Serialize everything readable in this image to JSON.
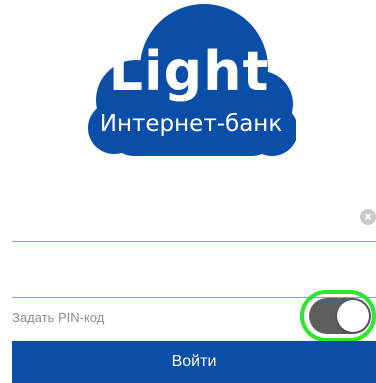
{
  "logo": {
    "title": "Light",
    "subtitle": "Интернет-банк",
    "cloud_color": "#0b4ea8",
    "text_color": "#ffffff"
  },
  "login_field": {
    "value": "",
    "placeholder": ""
  },
  "password_field": {
    "value": "",
    "placeholder": ""
  },
  "pin": {
    "label": "Задать PIN-код",
    "toggle_on": true,
    "highlight_color": "#2ee62e"
  },
  "login_button": {
    "label": "Войти",
    "color": "#0b4ea8"
  },
  "icons": {
    "clear": "clear-icon"
  }
}
